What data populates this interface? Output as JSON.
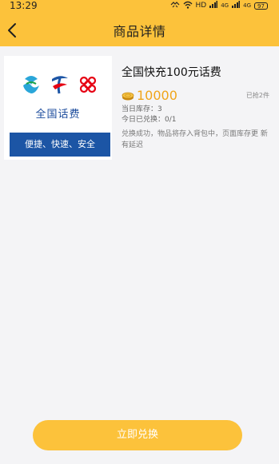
{
  "status_bar": {
    "time": "13:29",
    "net_label_1": "HD",
    "net_label_2": "4G",
    "net_label_3": "4G",
    "battery": "97"
  },
  "header": {
    "title": "商品详情",
    "back_icon": "chevron-left-icon"
  },
  "product_card": {
    "card_title": "全国话费",
    "slogan": "便捷、快速、安全",
    "brand_colors": {
      "blue": "#1c55a5",
      "red": "#e60012",
      "green": "#1aa14a"
    }
  },
  "product": {
    "name": "全国快充100元话费",
    "price": "10000",
    "sold": "已抢2件",
    "stock": "当日库存：3",
    "today_exchanged": "今日已兑换：0/1",
    "note": "兑换成功，物品将存入背包中，页面库存更 新有延迟"
  },
  "action": {
    "redeem_label": "立即兑换"
  },
  "colors": {
    "accent": "#fcc23b",
    "price": "#f0a51a",
    "background": "#f4f4f6"
  }
}
